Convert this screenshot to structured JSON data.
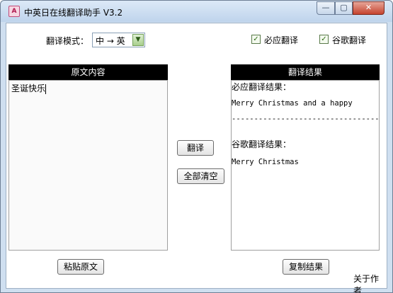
{
  "window": {
    "title": "中英日在线翻译助手 V3.2",
    "icon_glyph": "A",
    "minimize_glyph": "—",
    "maximize_glyph": "▢",
    "close_glyph": "✕"
  },
  "mode": {
    "label": "翻译模式：",
    "selected": "中 → 英",
    "dropdown_glyph": "▼"
  },
  "options": {
    "bing": {
      "label": "必应翻译",
      "checked": true,
      "check_glyph": "✓"
    },
    "google": {
      "label": "谷歌翻译",
      "checked": true,
      "check_glyph": "✓"
    }
  },
  "source": {
    "header": "原文内容",
    "text": "圣诞快乐"
  },
  "result": {
    "header": "翻译结果",
    "bing_heading": "必应翻译结果：",
    "bing_text": "Merry Christmas and a happy",
    "separator": "--------------------------------------",
    "google_heading": "谷歌翻译结果：",
    "google_text": "Merry Christmas"
  },
  "buttons": {
    "translate": "翻译",
    "clear_all": "全部清空",
    "paste": "粘贴原文",
    "copy": "复制结果"
  },
  "footer": {
    "about": "关于作者"
  }
}
